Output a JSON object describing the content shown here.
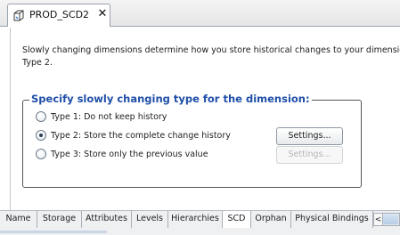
{
  "document_tab": {
    "title": "PROD_SCD2",
    "close_glyph": "✕",
    "icon": "dimension-cube-icon"
  },
  "description": {
    "line1": "Slowly changing dimensions determine how you store historical changes to your dimensio",
    "line2": "Type 2."
  },
  "group": {
    "legend": "Specify slowly changing type for the dimension:",
    "legend_color": "#1f4fa8"
  },
  "options": [
    {
      "label": "Type 1: Do not keep history",
      "selected": false
    },
    {
      "label": "Type 2: Store the complete change history",
      "selected": true
    },
    {
      "label": "Type 3: Store only the previous value",
      "selected": false
    }
  ],
  "settings_buttons": [
    {
      "label": "Settings...",
      "enabled": true
    },
    {
      "label": "Settings...",
      "enabled": false
    }
  ],
  "bottom_tabs": [
    {
      "label": "Name",
      "active": false
    },
    {
      "label": "Storage",
      "active": false
    },
    {
      "label": "Attributes",
      "active": false
    },
    {
      "label": "Levels",
      "active": false
    },
    {
      "label": "Hierarchies",
      "active": false
    },
    {
      "label": "SCD",
      "active": true
    },
    {
      "label": "Orphan",
      "active": false
    },
    {
      "label": "Physical Bindings",
      "active": false
    }
  ],
  "scroll": {
    "left_arrow": "<"
  }
}
